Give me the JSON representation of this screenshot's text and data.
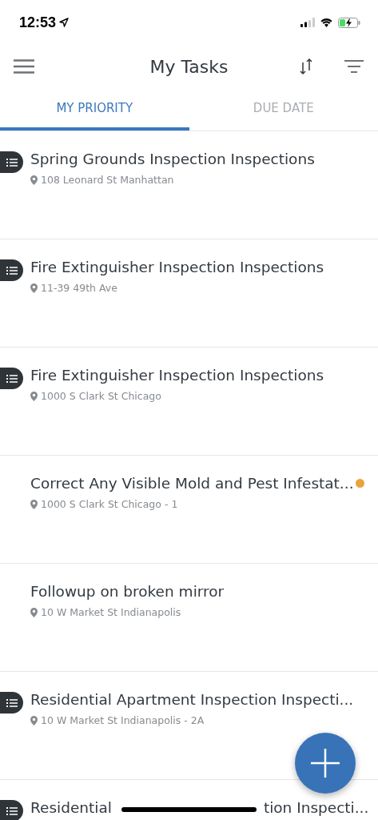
{
  "status_bar": {
    "time": "12:53"
  },
  "header": {
    "title": "My Tasks"
  },
  "tabs": [
    {
      "label": "MY PRIORITY",
      "selected": true
    },
    {
      "label": "DUE DATE",
      "selected": false
    }
  ],
  "tasks": [
    {
      "kind": "checklist",
      "title": "Spring Grounds Inspection Inspections",
      "address": "108 Leonard St Manhattan"
    },
    {
      "kind": "checklist",
      "title": "Fire Extinguisher Inspection Inspections",
      "address": "11-39 49th Ave"
    },
    {
      "kind": "checklist",
      "title": "Fire Extinguisher Inspection Inspections",
      "address": "1000 S Clark St Chicago"
    },
    {
      "kind": "plain",
      "title": "Correct Any Visible Mold and Pest Infestat...",
      "address": "1000 S Clark St Chicago - 1",
      "color": "#e8a33a"
    },
    {
      "kind": "plain",
      "title": "Followup on broken mirror",
      "address": "10 W Market St Indianapolis"
    },
    {
      "kind": "checklist",
      "title": "Residential Apartment Inspection Inspecti...",
      "address": "10 W Market St Indianapolis - 2A"
    },
    {
      "kind": "checklist",
      "title_parts": [
        "Residential",
        "tion Inspecti..."
      ]
    }
  ]
}
